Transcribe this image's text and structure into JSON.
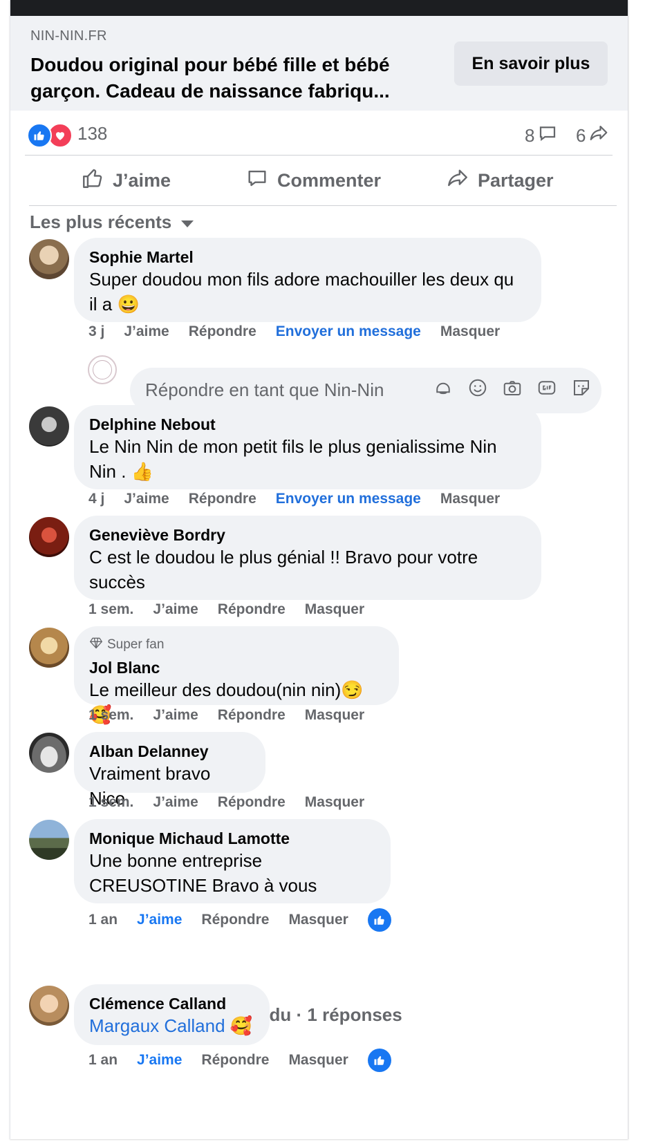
{
  "link_preview": {
    "domain": "NIN-NIN.FR",
    "title": "Doudou original pour bébé fille et bébé garçon. Cadeau de naissance fabriqu...",
    "cta_label": "En savoir plus"
  },
  "stats": {
    "reactions_count": "138",
    "comments_count": "8",
    "shares_count": "6"
  },
  "actions": {
    "like": "J’aime",
    "comment": "Commenter",
    "share": "Partager"
  },
  "sort": {
    "label": "Les plus récents"
  },
  "reply_box": {
    "placeholder": "Répondre en tant que Nin-Nin"
  },
  "comments": [
    {
      "name": "Sophie Martel",
      "text": "Super doudou mon fils adore machouiller les deux qu il a 😀",
      "time": "3 j",
      "like": "J’aime",
      "reply": "Répondre",
      "message": "Envoyer un message",
      "hide": "Masquer"
    },
    {
      "name": "Delphine Nebout",
      "text": "Le Nin Nin de mon petit fils le plus genialissime Nin Nin . 👍",
      "time": "4 j",
      "like": "J’aime",
      "reply": "Répondre",
      "message": "Envoyer un message",
      "hide": "Masquer"
    },
    {
      "name": "Geneviève Bordry",
      "text": "C est le doudou le plus génial !! Bravo pour votre succès",
      "time": "1 sem.",
      "like": "J’aime",
      "reply": "Répondre",
      "hide": "Masquer"
    },
    {
      "badge": "Super fan",
      "name": "Jol Blanc",
      "text": "Le meilleur des doudou(nin nin)😏🥰",
      "time": "1 sem.",
      "like": "J’aime",
      "reply": "Répondre",
      "hide": "Masquer"
    },
    {
      "name": "Alban Delanney",
      "text": "Vraiment bravo Nico",
      "time": "1 sem.",
      "like": "J’aime",
      "reply": "Répondre",
      "hide": "Masquer"
    },
    {
      "name": "Monique Michaud Lamotte",
      "text": "Une bonne entreprise CREUSOTINE Bravo à vous",
      "time": "1 an",
      "like": "J’aime",
      "reply": "Répondre",
      "hide": "Masquer"
    },
    {
      "name": "Clémence Calland",
      "mention": "Margaux Calland",
      "text": "🥰",
      "time": "1 an",
      "like": "J’aime",
      "reply": "Répondre",
      "hide": "Masquer"
    }
  ],
  "page_reply": {
    "label": "Nin-Nin a répondu · 1 réponses"
  },
  "colors": {
    "accent": "#1877f2",
    "bubble": "#f0f2f5",
    "muted_text": "#65676b",
    "love": "#f33e58"
  }
}
